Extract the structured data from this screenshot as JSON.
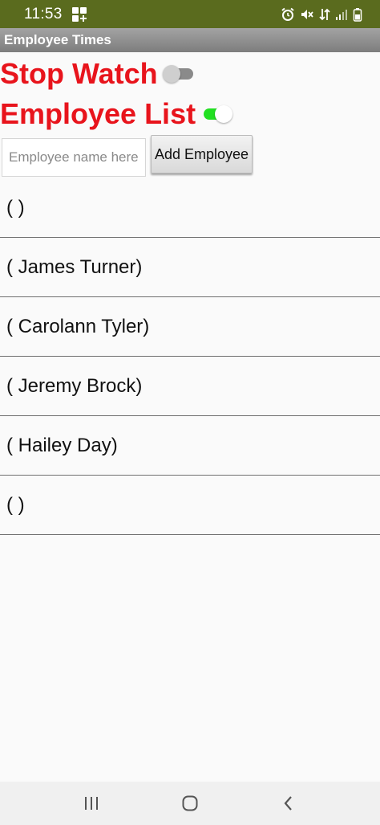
{
  "status_bar": {
    "time": "11:53",
    "background": "#5a6b1e",
    "icons": [
      "app-grid-icon",
      "alarm-icon",
      "mute-icon",
      "data-icon",
      "signal-icon",
      "battery-icon"
    ]
  },
  "title_bar": {
    "title": "Employee Times"
  },
  "switches": {
    "stop_watch": {
      "label": "Stop Watch",
      "state": "off"
    },
    "employee_list": {
      "label": "Employee List",
      "state": "on"
    }
  },
  "entry": {
    "placeholder": "Employee name here",
    "value": "",
    "add_button_label": "Add Employee"
  },
  "employees": [
    "( )",
    "( James Turner)",
    "( Carolann Tyler)",
    "( Jeremy Brock)",
    "( Hailey Day)",
    "( )"
  ],
  "nav_bar": {
    "icons": [
      "recent-apps-icon",
      "home-icon",
      "back-icon"
    ]
  },
  "colors": {
    "label_red": "#e8141c",
    "switch_on": "#22e022",
    "title_bar": "#8f8f8f"
  }
}
